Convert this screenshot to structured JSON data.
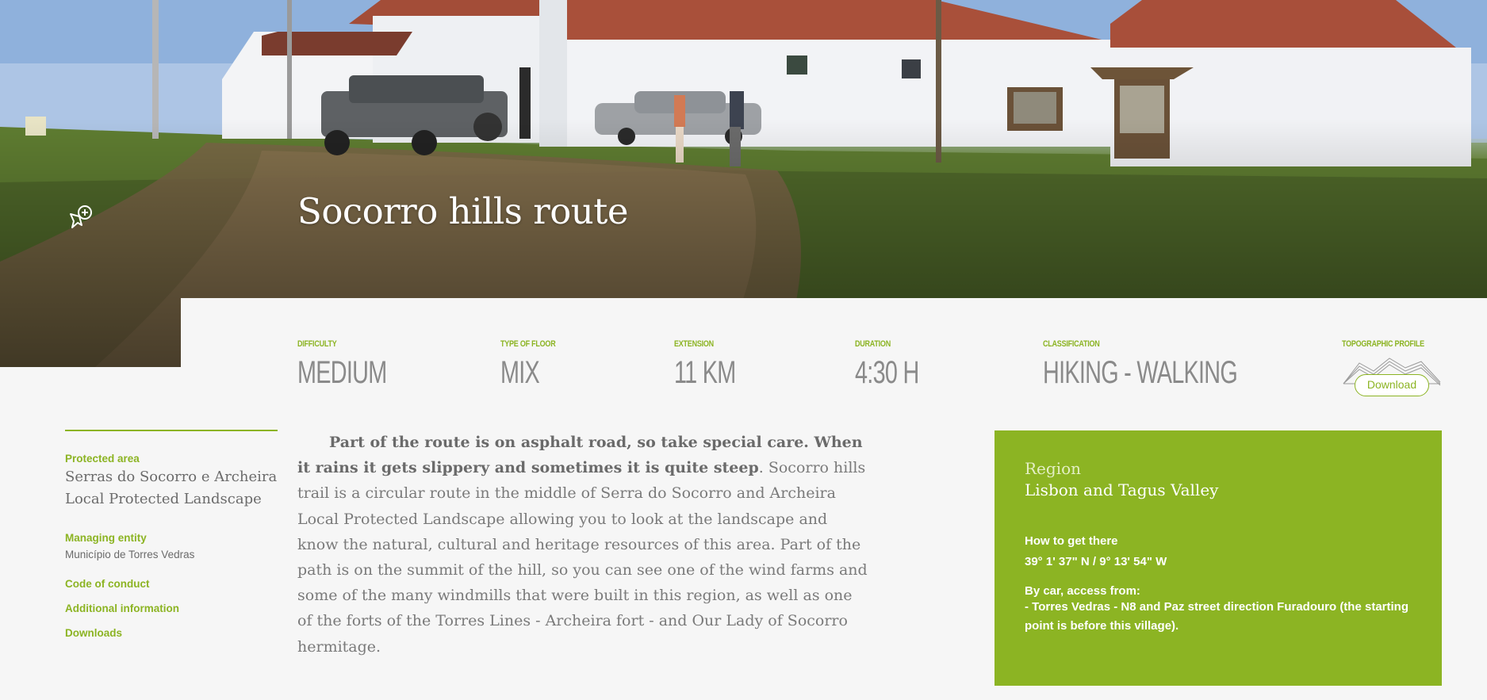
{
  "hero": {
    "title": "Socorro hills route"
  },
  "stats": [
    {
      "label": "DIFFICULTY",
      "value": "MEDIUM"
    },
    {
      "label": "TYPE OF FLOOR",
      "value": "MIX"
    },
    {
      "label": "EXTENSION",
      "value": "11 KM"
    },
    {
      "label": "DURATION",
      "value": "4:30 H"
    },
    {
      "label": "CLASSIFICATION",
      "value": "HIKING - WALKING"
    }
  ],
  "topographic": {
    "label": "TOPOGRAPHIC PROFILE",
    "download_label": "Download"
  },
  "sidebar": {
    "protected_area_label": "Protected area",
    "protected_area_value": "Serras do Socorro e Archeira Local Protected Landscape",
    "managing_entity_label": "Managing entity",
    "managing_entity_value": "Município de Torres Vedras",
    "code_of_conduct": "Code of conduct",
    "additional_information": "Additional information",
    "downloads": "Downloads"
  },
  "description": {
    "lead": "Part of the route is on asphalt road, so take special care. When it rains it gets slippery and sometimes it is quite steep",
    "body": ". Socorro hills trail is a circular route in the middle of Serra do Socorro and Archeira Local Protected Landscape allowing you to look at the landscape and know the natural, cultural and heritage resources of this area. Part of the path is on the summit of the hill, so you can see one of the wind farms and some of the many windmills that were built in this region, as well as one of the forts of the Torres Lines - Archeira fort - and Our Lady of Socorro hermitage."
  },
  "region": {
    "label": "Region",
    "name": "Lisbon and Tagus Valley",
    "how_to_get_label": "How to get there",
    "coordinates": "39° 1' 37\" N / 9° 13' 54\" W",
    "by_car_label": "By car, access from:",
    "by_car_text": "- Torres Vedras - N8 and Paz street direction Furadouro (the starting point is before this village)."
  },
  "colors": {
    "accent": "#8cb423",
    "text": "#7a7a7a",
    "background": "#f6f6f6"
  },
  "icons": {
    "favorite": "pin-add-icon",
    "topographic": "mountain-profile-icon"
  }
}
